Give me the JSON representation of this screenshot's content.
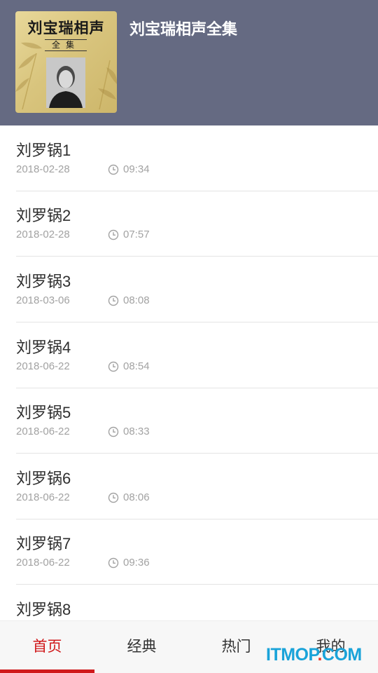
{
  "header": {
    "title": "刘宝瑞相声全集",
    "cover": {
      "title": "刘宝瑞相声",
      "subtitle": "全集"
    },
    "background_color": "#656a82"
  },
  "episodes": [
    {
      "title": "刘罗锅1",
      "date": "2018-02-28",
      "duration": "09:34"
    },
    {
      "title": "刘罗锅2",
      "date": "2018-02-28",
      "duration": "07:57"
    },
    {
      "title": "刘罗锅3",
      "date": "2018-03-06",
      "duration": "08:08"
    },
    {
      "title": "刘罗锅4",
      "date": "2018-06-22",
      "duration": "08:54"
    },
    {
      "title": "刘罗锅5",
      "date": "2018-06-22",
      "duration": "08:33"
    },
    {
      "title": "刘罗锅6",
      "date": "2018-06-22",
      "duration": "08:06"
    },
    {
      "title": "刘罗锅7",
      "date": "2018-06-22",
      "duration": "09:36"
    },
    {
      "title": "刘罗锅8",
      "date": "",
      "duration": ""
    }
  ],
  "tabs": [
    {
      "label": "首页",
      "active": true
    },
    {
      "label": "经典",
      "active": false
    },
    {
      "label": "热门",
      "active": false
    },
    {
      "label": "我的",
      "active": false
    }
  ],
  "accent_color": "#d0191b",
  "watermark": {
    "text_main": "ITMOP",
    "text_dot": ".",
    "text_tail": "COM"
  },
  "icons": {
    "duration": "clock-icon"
  }
}
